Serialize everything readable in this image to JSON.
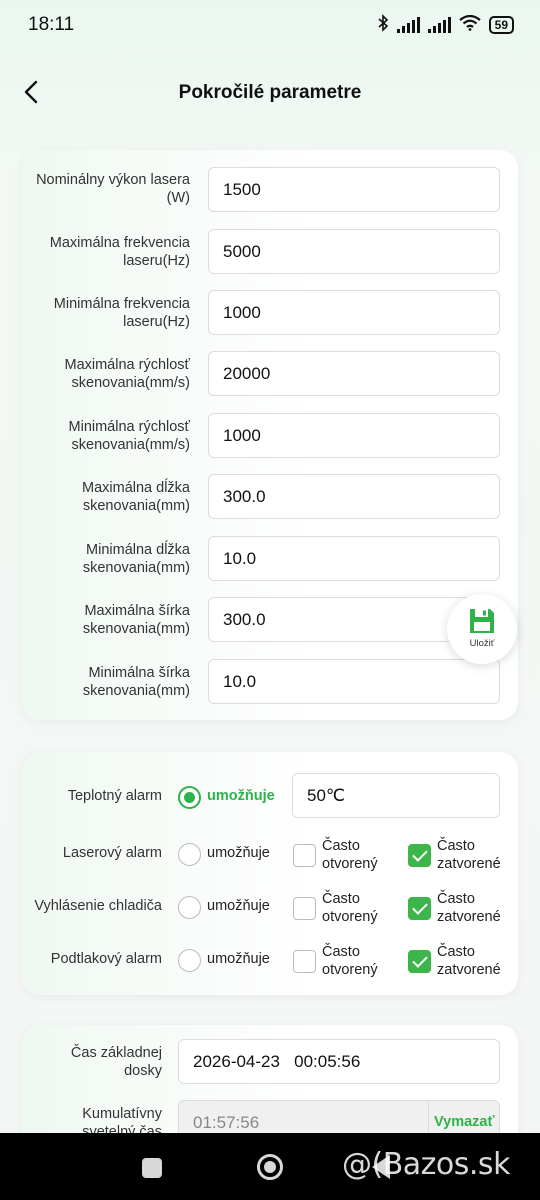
{
  "status_bar": {
    "time": "18:11",
    "battery": "59",
    "icons": [
      "bluetooth-icon",
      "signal-icon",
      "signal-icon",
      "wifi-icon",
      "battery-icon"
    ]
  },
  "header": {
    "title": "Pokročilé parametre",
    "back_icon": "chevron-left-icon"
  },
  "params": [
    {
      "label": "Nominálny výkon lasera (W)",
      "value": "1500"
    },
    {
      "label": "Maximálna frekvencia laseru(Hz)",
      "value": "5000"
    },
    {
      "label": "Minimálna frekvencia laseru(Hz)",
      "value": "1000"
    },
    {
      "label": "Maximálna rýchlosť skenovania(mm/s)",
      "value": "20000"
    },
    {
      "label": "Minimálna rýchlosť skenovania(mm/s)",
      "value": "1000"
    },
    {
      "label": "Maximálna dĺžka skenovania(mm)",
      "value": "300.0"
    },
    {
      "label": "Minimálna dĺžka skenovania(mm)",
      "value": "10.0"
    },
    {
      "label": "Maximálna šírka skenovania(mm)",
      "value": "300.0"
    },
    {
      "label": "Minimálna šírka skenovania(mm)",
      "value": "10.0"
    }
  ],
  "save": {
    "label": "Uložiť",
    "icon": "floppy-disk-icon",
    "color": "#2db34a"
  },
  "alarms": {
    "temp": {
      "label": "Teplotný alarm",
      "option": "umožňuje",
      "enabled": true,
      "value": "50℃"
    },
    "rows": [
      {
        "label": "Laserový alarm",
        "option": "umožňuje",
        "open_label_1": "Často",
        "open_label_2": "otvorený",
        "closed_label_1": "Často",
        "closed_label_2": "zatvorené"
      },
      {
        "label": "Vyhlásenie chladiča",
        "option": "umožňuje",
        "open_label_1": "Často",
        "open_label_2": "otvorený",
        "closed_label_1": "Často",
        "closed_label_2": "zatvorené"
      },
      {
        "label": "Podtlakový alarm",
        "option": "umožňuje",
        "open_label_1": "Často",
        "open_label_2": "otvorený",
        "closed_label_1": "Často",
        "closed_label_2": "zatvorené"
      }
    ]
  },
  "time_section": {
    "base_label_1": "Čas základnej",
    "base_label_2": "dosky",
    "base_date": "2026-04-23",
    "base_time": "00:05:56",
    "cum_label_1": "Kumulatívny",
    "cum_label_2": "svetelný čas",
    "cum_value": "01:57:56",
    "clear_label": "Vymazať"
  },
  "watermark": "@(Bazos.sk",
  "accent_color": "#2db34a"
}
